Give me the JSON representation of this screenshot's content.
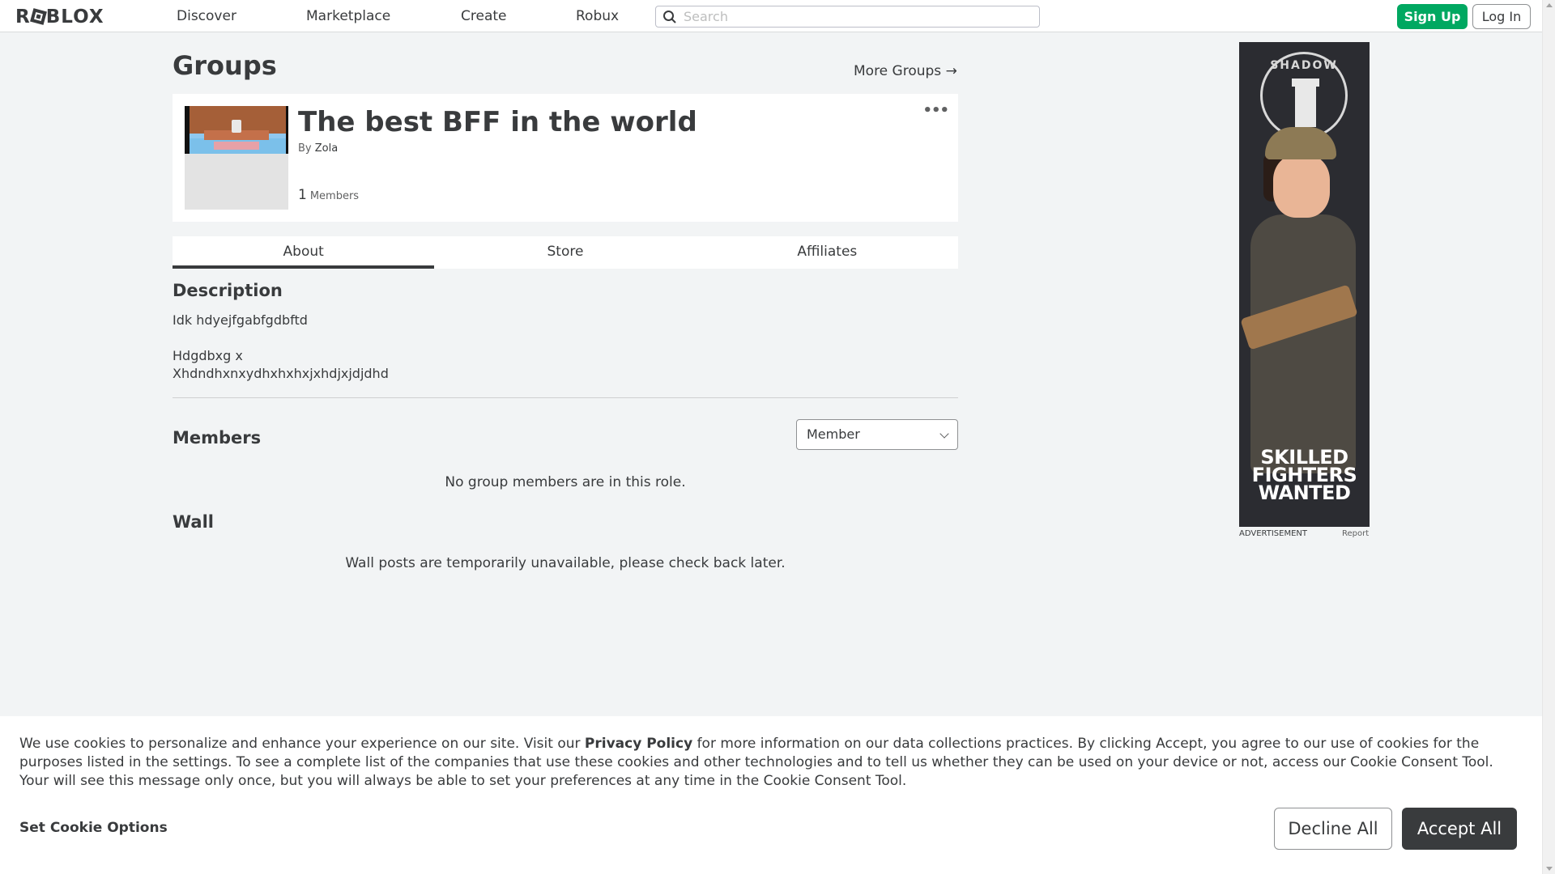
{
  "nav": {
    "logo": "ROBLOX",
    "links": [
      "Discover",
      "Marketplace",
      "Create",
      "Robux"
    ],
    "search_placeholder": "Search",
    "signup_label": "Sign Up",
    "login_label": "Log In"
  },
  "page": {
    "title": "Groups",
    "more_groups": "More Groups →"
  },
  "group": {
    "name": "The best BFF in the world",
    "by_prefix": "By",
    "owner": "Zola",
    "member_count": "1",
    "member_label": "Members",
    "more_menu": "•••"
  },
  "tabs": [
    "About",
    "Store",
    "Affiliates"
  ],
  "about": {
    "description_heading": "Description",
    "description_lines": [
      "Idk hdyejfgabfgdbftd",
      "",
      "Hdgdbxg x",
      "Xhdndhxnxydhxhxhxjxhdjxjdjdhd"
    ],
    "members_heading": "Members",
    "role_selected": "Member",
    "no_members": "No group members are in this role.",
    "wall_heading": "Wall",
    "wall_message": "Wall posts are temporarily unavailable, please check back later."
  },
  "ad": {
    "emblem_text": "SHADOW",
    "headline": "SKILLED FIGHTERS WANTED",
    "label": "ADVERTISEMENT",
    "report": "Report"
  },
  "cookie": {
    "text_before": "We use cookies to personalize and enhance your experience on our site. Visit our ",
    "policy_link": "Privacy Policy",
    "text_after": " for more information on our data collections practices. By clicking Accept, you agree to our use of cookies for the purposes listed in the settings. To see a complete list of the companies that use these cookies and other technologies and to tell us whether they can be used on your device or not, access our Cookie Consent Tool. Your will see this message only once, but you will always be able to set your preferences at any time in the Cookie Consent Tool.",
    "options_label": "Set Cookie Options",
    "decline_label": "Decline All",
    "accept_label": "Accept All"
  },
  "colors": {
    "signup_green": "#00a861",
    "text_dark": "#393b3d",
    "page_bg": "#f2f4f5"
  }
}
